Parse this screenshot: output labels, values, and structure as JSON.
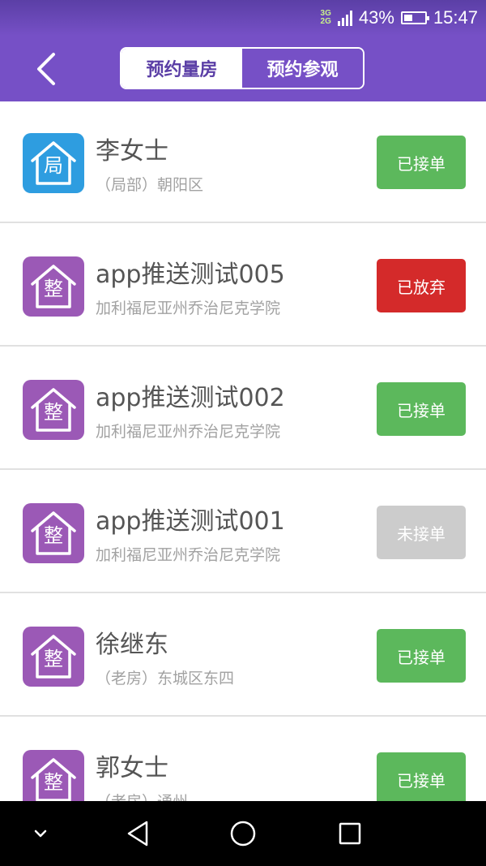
{
  "status_bar": {
    "network_top": "3G",
    "network_bottom": "2G",
    "battery": "43%",
    "battery_level": 0.43,
    "time": "15:47"
  },
  "header": {
    "back_icon": "chevron-left-icon",
    "tabs": [
      {
        "label": "预约量房",
        "active": true
      },
      {
        "label": "预约参观",
        "active": false
      }
    ]
  },
  "items": [
    {
      "icon_char": "局",
      "icon_color": "#2e9de0",
      "name": "李女士",
      "sub": "（局部）朝阳区",
      "status": "已接单",
      "status_color": "#5cb85c"
    },
    {
      "icon_char": "整",
      "icon_color": "#9b59b6",
      "name": "app推送测试005",
      "sub": "加利福尼亚州乔治尼克学院",
      "status": "已放弃",
      "status_color": "#d42a2a"
    },
    {
      "icon_char": "整",
      "icon_color": "#9b59b6",
      "name": "app推送测试002",
      "sub": "加利福尼亚州乔治尼克学院",
      "status": "已接单",
      "status_color": "#5cb85c"
    },
    {
      "icon_char": "整",
      "icon_color": "#9b59b6",
      "name": "app推送测试001",
      "sub": "加利福尼亚州乔治尼克学院",
      "status": "未接单",
      "status_color": "#cccccc"
    },
    {
      "icon_char": "整",
      "icon_color": "#9b59b6",
      "name": "徐继东",
      "sub": "（老房）东城区东四",
      "status": "已接单",
      "status_color": "#5cb85c"
    },
    {
      "icon_char": "整",
      "icon_color": "#9b59b6",
      "name": "郭女士",
      "sub": "（老房）通州",
      "status": "已接单",
      "status_color": "#5cb85c"
    }
  ],
  "nav_bar": {
    "icons": [
      "chevron-down-icon",
      "back-triangle-icon",
      "home-circle-icon",
      "recents-square-icon"
    ]
  },
  "colors": {
    "header_purple": "#7650c6",
    "accepted_green": "#5cb85c",
    "abandoned_red": "#d42a2a",
    "pending_gray": "#cccccc"
  }
}
